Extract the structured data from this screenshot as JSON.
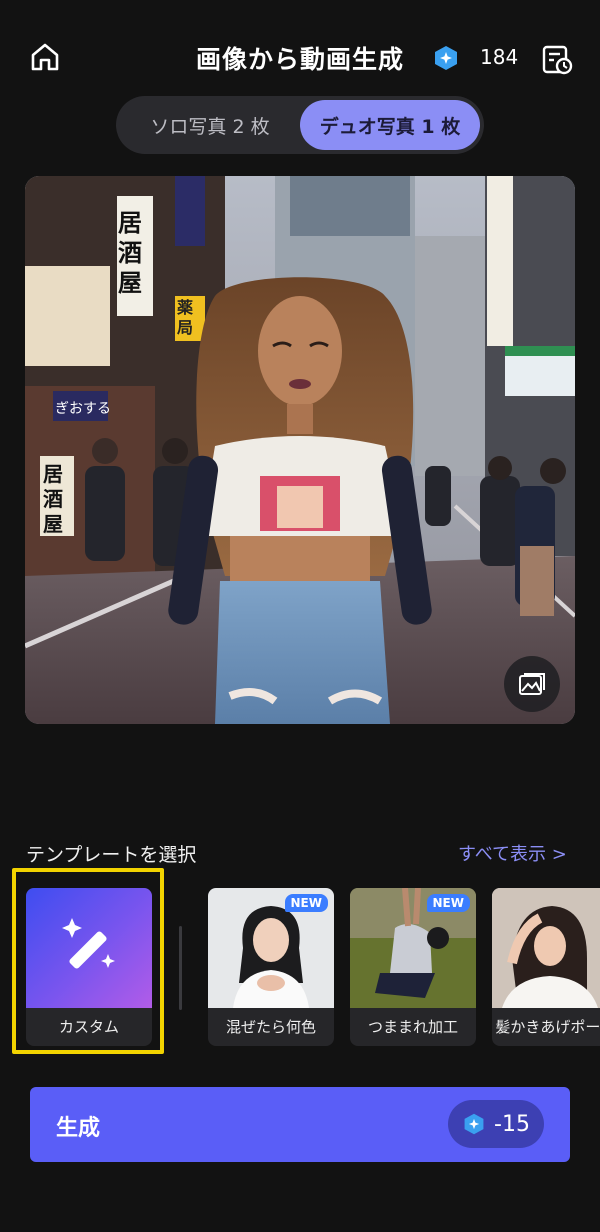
{
  "header": {
    "title": "画像から動画生成",
    "credits": "184",
    "home_icon": "home-icon",
    "credit_icon": "credit-gem-icon",
    "history_icon": "history-calendar-icon"
  },
  "mode_tabs": [
    {
      "label": "ソロ写真 2 枚",
      "selected": false
    },
    {
      "label": "デュオ写真 1 枚",
      "selected": true
    }
  ],
  "hero": {
    "shop_signs": [
      "居酒屋",
      "薬局",
      "ぎおする",
      "居酒屋"
    ],
    "image_button_icon": "image-gallery-icon"
  },
  "templates": {
    "section_label": "テンプレートを選択",
    "see_all": "すべて表示 >",
    "items": [
      {
        "label": "カスタム",
        "icon": "magic-wand-icon",
        "new": false,
        "selected": true
      },
      {
        "label": "混ぜたら何色",
        "new": true
      },
      {
        "label": "つままれ加工",
        "new": true
      },
      {
        "label": "髪かきあげポーズ",
        "new": false
      }
    ],
    "new_badge": "NEW"
  },
  "generate": {
    "label": "生成",
    "cost": "-15"
  },
  "colors": {
    "background": "#121212",
    "accent": "#5a5ef7",
    "selected_tab": "#8b8ef5",
    "highlight": "#f2d300"
  }
}
